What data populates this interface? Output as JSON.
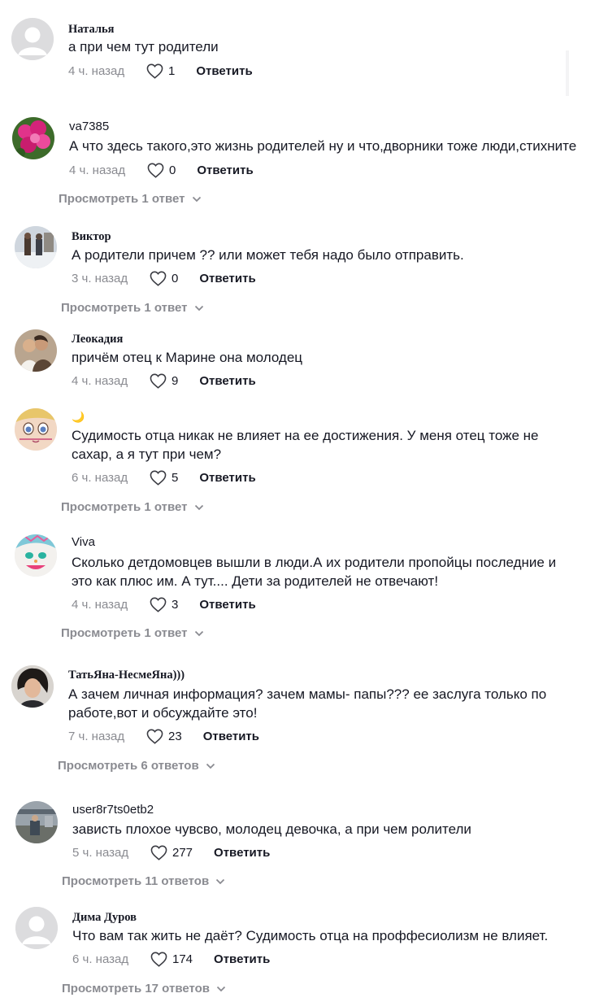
{
  "comments": [
    {
      "user": "Наталья",
      "text": [
        "а при чем тут родители"
      ],
      "time": "4 ч. назад",
      "likes": "1",
      "reply_label": "Ответить",
      "replies": ""
    },
    {
      "user": "va7385",
      "text": [
        "А что здесь такого,это жизнь родителей ну и что,дворники тоже люди,стихните"
      ],
      "time": "4 ч. назад",
      "likes": "0",
      "reply_label": "Ответить",
      "replies": "Просмотреть 1 ответ"
    },
    {
      "user": "Виктор",
      "text": [
        "А родители причем ?? или может тебя надо было отправить."
      ],
      "time": "3 ч. назад",
      "likes": "0",
      "reply_label": "Ответить",
      "replies": "Просмотреть 1 ответ"
    },
    {
      "user": "Леокадия",
      "text": [
        "причём отец к Марине она молодец"
      ],
      "time": "4 ч. назад",
      "likes": "9",
      "reply_label": "Ответить",
      "replies": ""
    },
    {
      "user": "🌙",
      "text": [
        "Судимость отца никак не влияет на ее достижения. У меня отец тоже не",
        "сахар, а я тут при чем?"
      ],
      "time": "6 ч. назад",
      "likes": "5",
      "reply_label": "Ответить",
      "replies": "Просмотреть 1 ответ"
    },
    {
      "user": "Viva",
      "text": [
        "Сколько детдомовцев вышли в люди.А их родители пропойцы последние и",
        "это как плюс им. А тут.... Дети за родителей не отвечают!"
      ],
      "time": "4 ч. назад",
      "likes": "3",
      "reply_label": "Ответить",
      "replies": "Просмотреть 1 ответ"
    },
    {
      "user": "ТатьЯна-НесмеЯна)))",
      "text": [
        "А зачем личная информация? зачем мамы- папы??? ее заслуга только по",
        "работе,вот и обсуждайте это!"
      ],
      "time": "7 ч. назад",
      "likes": "23",
      "reply_label": "Ответить",
      "replies": "Просмотреть 6 ответов"
    },
    {
      "user": "user8r7ts0etb2",
      "text": [
        "зависть плохое чувсво, молодец девочка, а при чем ролители"
      ],
      "time": "5 ч. назад",
      "likes": "277",
      "reply_label": "Ответить",
      "replies": "Просмотреть 11 ответов"
    },
    {
      "user": "Дима Дуров",
      "text": [
        "Что вам так жить не даёт? Судимость отца на проффесиолизм не влияет."
      ],
      "time": "6 ч. назад",
      "likes": "174",
      "reply_label": "Ответить",
      "replies": "Просмотреть 17 ответов"
    }
  ],
  "icons": {
    "like": "heart-outline-icon",
    "expand": "chevron-down-icon",
    "avatar_default": "default-user-avatar-icon"
  },
  "colors": {
    "text": "#161823",
    "muted": "#8a8b91",
    "avatar_bg": "#e4e4e6"
  }
}
